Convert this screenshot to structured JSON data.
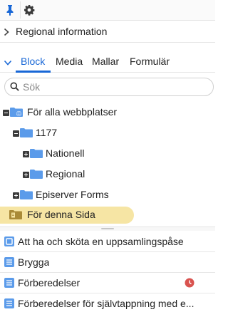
{
  "toolbar": {
    "pin_icon": "pin-icon",
    "gear_icon": "gear-icon"
  },
  "regional": {
    "label": "Regional information",
    "icon": "chevron-right-icon"
  },
  "tabs": [
    {
      "label": "Block"
    },
    {
      "label": "Media"
    },
    {
      "label": "Mallar"
    },
    {
      "label": "Formulär"
    }
  ],
  "search": {
    "placeholder": "Sök",
    "icon": "search-icon"
  },
  "tree": {
    "items": [
      {
        "label": "För alla webbplatser",
        "expander": "minus"
      },
      {
        "label": "1177",
        "expander": "minus"
      },
      {
        "label": "Nationell",
        "expander": "plus"
      },
      {
        "label": "Regional",
        "expander": "plus"
      },
      {
        "label": "Episerver Forms",
        "expander": "plus"
      },
      {
        "label": "För denna Sida",
        "selected": true
      }
    ]
  },
  "blocks": {
    "items": [
      {
        "label": "Att ha och sköta en uppsamlingspåse",
        "icon": "block-icon"
      },
      {
        "label": "Brygga",
        "icon": "list-block-icon"
      },
      {
        "label": "Förberedelser",
        "icon": "list-block-icon",
        "status_icon": "clock-icon"
      },
      {
        "label": "Förberedelser för självtappning med e...",
        "icon": "list-block-icon"
      }
    ]
  },
  "colors": {
    "accent": "#1867d6",
    "folder": "#5b9bea",
    "highlight": "#f6e5a4",
    "clock": "#d9534f"
  }
}
